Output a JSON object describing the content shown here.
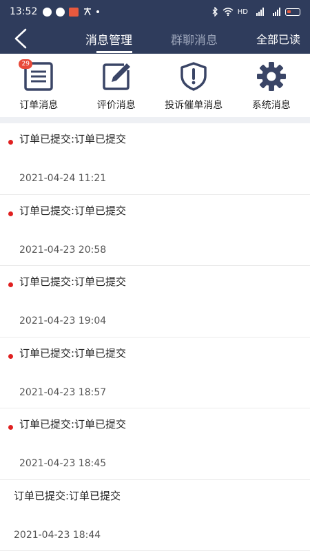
{
  "status_bar": {
    "time": "13:52",
    "network_label": "HD"
  },
  "nav": {
    "tab_active": "消息管理",
    "tab_inactive": "群聊消息",
    "read_all": "全部已读"
  },
  "categories": [
    {
      "label": "订单消息",
      "icon": "order-list-icon",
      "badge": "29"
    },
    {
      "label": "评价消息",
      "icon": "edit-icon"
    },
    {
      "label": "投诉催单消息",
      "icon": "shield-alert-icon"
    },
    {
      "label": "系统消息",
      "icon": "gear-icon"
    }
  ],
  "messages": [
    {
      "title": "订单已提交:订单已提交",
      "time": "2021-04-24 11:21",
      "unread": true
    },
    {
      "title": "订单已提交:订单已提交",
      "time": "2021-04-23 20:58",
      "unread": true
    },
    {
      "title": "订单已提交:订单已提交",
      "time": "2021-04-23 19:04",
      "unread": true
    },
    {
      "title": "订单已提交:订单已提交",
      "time": "2021-04-23 18:57",
      "unread": true
    },
    {
      "title": "订单已提交:订单已提交",
      "time": "2021-04-23 18:45",
      "unread": true
    },
    {
      "title": "订单已提交:订单已提交",
      "time": "2021-04-23 18:44",
      "unread": false
    }
  ],
  "colors": {
    "header_bg": "#2f3c5c",
    "icon_color": "#3a4566",
    "unread_dot": "#e02020",
    "badge": "#e84a3a"
  }
}
